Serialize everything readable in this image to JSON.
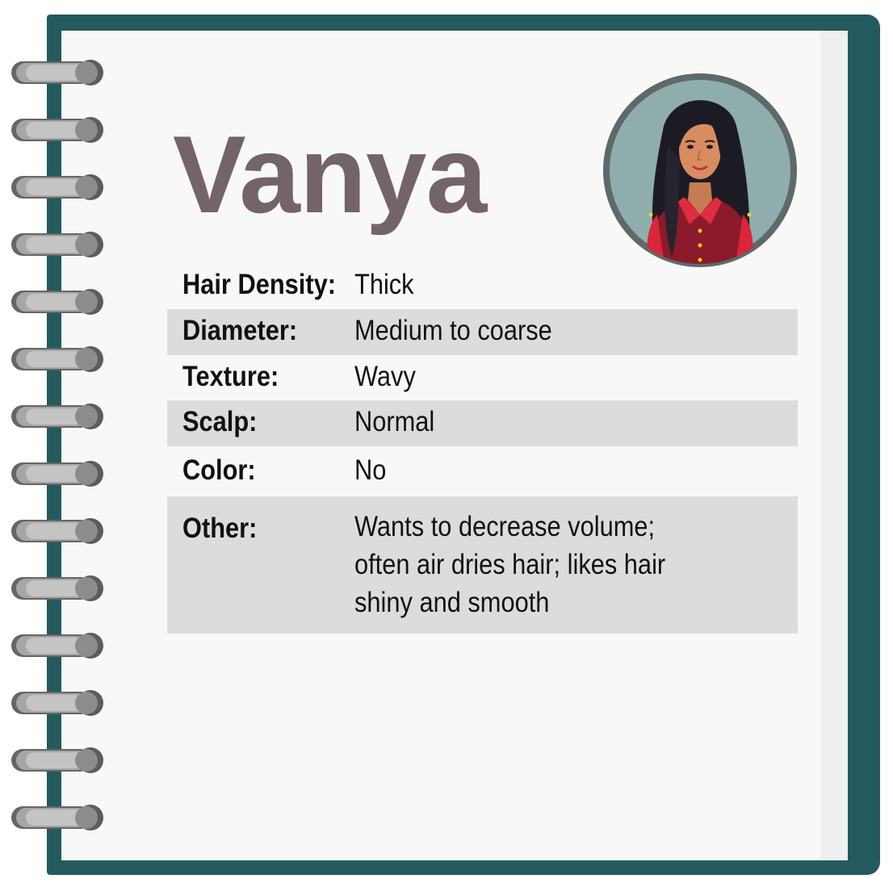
{
  "profile": {
    "name": "Vanya"
  },
  "attributes": [
    {
      "label": "Hair Density:",
      "value": "Thick"
    },
    {
      "label": "Diameter:",
      "value": "Medium to coarse"
    },
    {
      "label": "Texture:",
      "value": "Wavy"
    },
    {
      "label": "Scalp:",
      "value": "Normal"
    },
    {
      "label": "Color:",
      "value": "No"
    }
  ],
  "other": {
    "label": "Other:",
    "lines": [
      "Wants to decrease volume;",
      "often air dries hair; likes hair",
      "shiny and smooth"
    ]
  },
  "colors": {
    "notebook_cover": "#225a5e",
    "page": "#f8f8f8",
    "row_shade": "#dcdcdc",
    "name_text": "#736469"
  },
  "icons": {
    "binding": "spiral-ring-icon",
    "avatar": "woman-avatar-icon"
  }
}
